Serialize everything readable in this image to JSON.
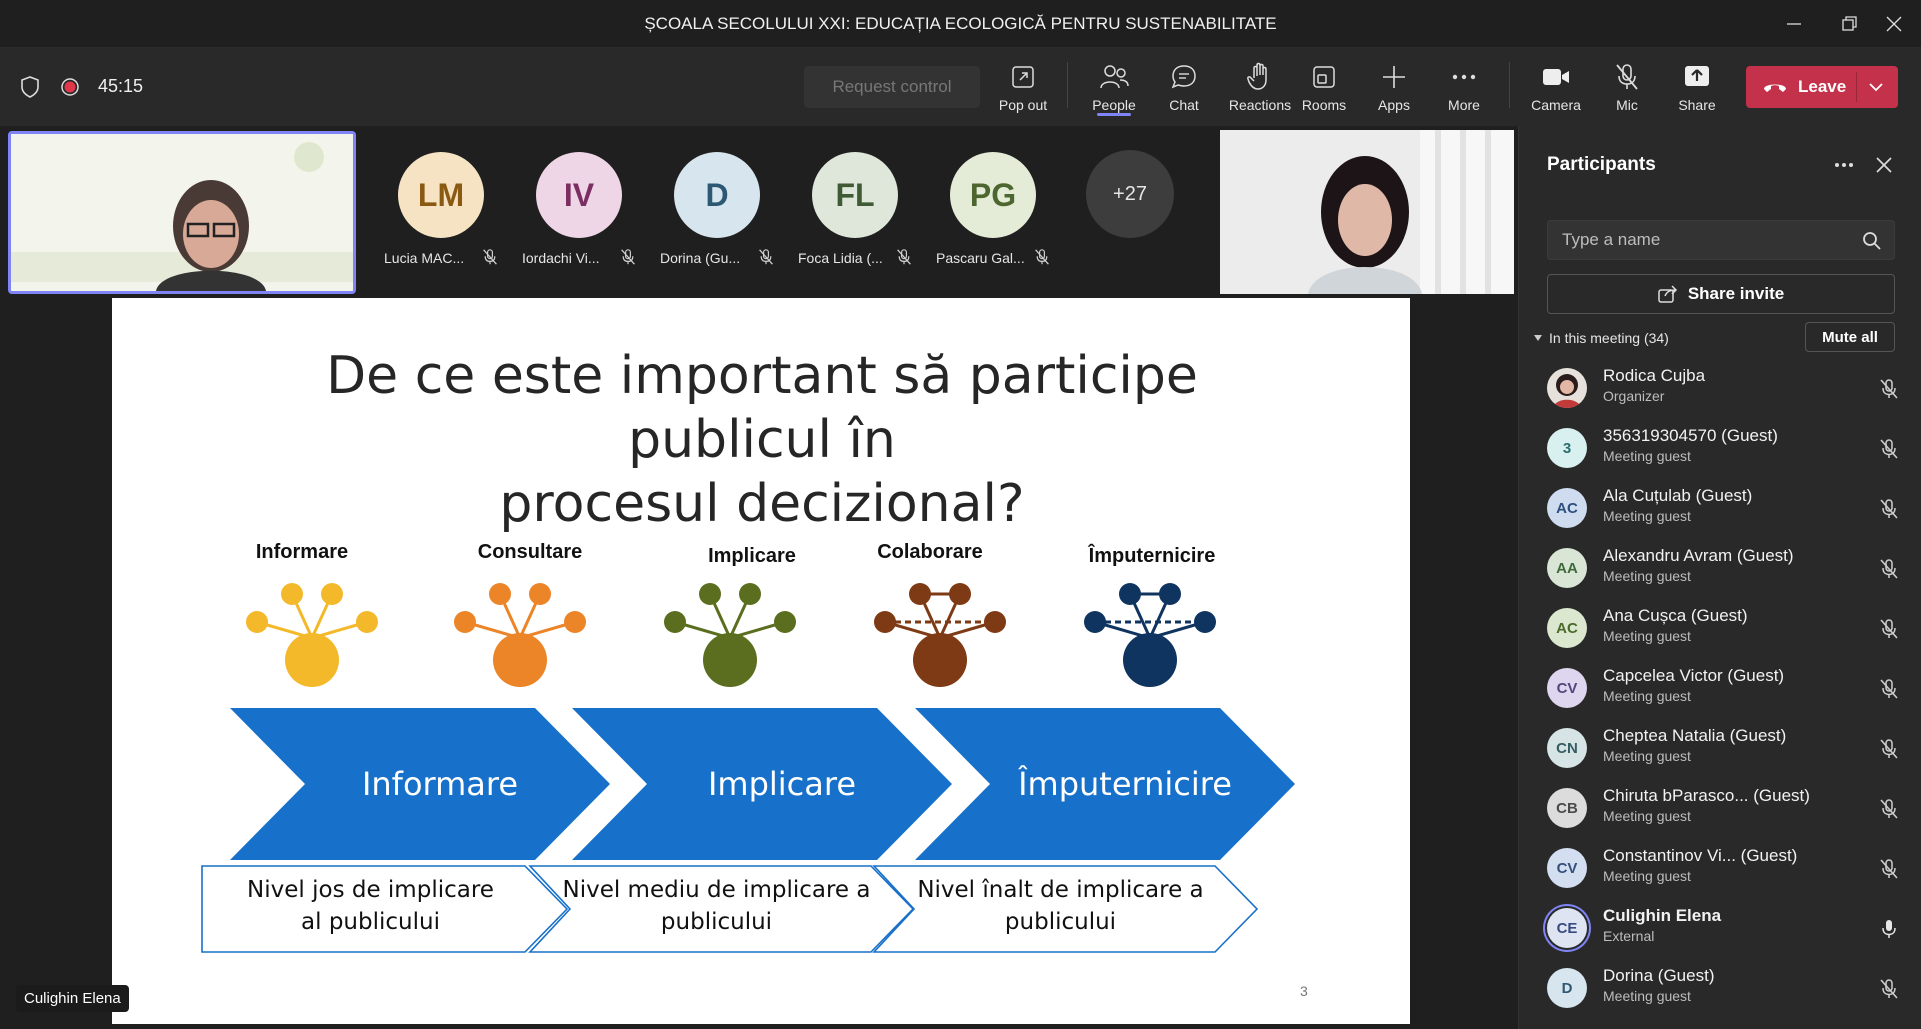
{
  "window": {
    "title": "ȘCOALA SECOLULUI XXI: EDUCAȚIA ECOLOGICĂ PENTRU SUSTENABILITATE"
  },
  "toolbar": {
    "timer": "45:15",
    "request_control": "Request control",
    "pop_out": "Pop out",
    "people": "People",
    "chat": "Chat",
    "reactions": "Reactions",
    "rooms": "Rooms",
    "apps": "Apps",
    "more": "More",
    "camera": "Camera",
    "mic": "Mic",
    "share": "Share",
    "leave": "Leave"
  },
  "gallery": {
    "tiles": [
      {
        "initials": "LM",
        "name": "Lucia MAC...",
        "bg": "#f6e3c3",
        "fg": "#8a5a12"
      },
      {
        "initials": "IV",
        "name": "Iordachi Vi...",
        "bg": "#efd6e6",
        "fg": "#7b2e62"
      },
      {
        "initials": "D",
        "name": "Dorina (Gu...",
        "bg": "#d7e5ee",
        "fg": "#2d5874"
      },
      {
        "initials": "FL",
        "name": "Foca Lidia (...",
        "bg": "#dfe6da",
        "fg": "#3f5a34"
      },
      {
        "initials": "PG",
        "name": "Pascaru Gal...",
        "bg": "#e4ecd7",
        "fg": "#4d6630"
      }
    ],
    "overflow": "+27"
  },
  "slide": {
    "title_line1": "De ce este important să participe publicul în",
    "title_line2": "procesul decizional?",
    "stages": [
      "Informare",
      "Consultare",
      "Implicare",
      "Colaborare",
      "Împuternicire"
    ],
    "stage_colors": [
      "#f4b92a",
      "#ec8428",
      "#5b6e1f",
      "#7e3a14",
      "#0f3460"
    ],
    "chevrons": [
      "Informare",
      "Implicare",
      "Împuternicire"
    ],
    "levels": [
      {
        "line1": "Nivel jos de implicare",
        "line2": "al publicului"
      },
      {
        "line1": "Nivel mediu de implicare a",
        "line2": "publicului"
      },
      {
        "line1": "Nivel înalt de implicare a",
        "line2": "publicului"
      }
    ],
    "page_number": "3",
    "chevron_color": "#1770c9"
  },
  "presenter_label": "Culighin Elena",
  "panel": {
    "title": "Participants",
    "search_placeholder": "Type a name",
    "share_invite": "Share invite",
    "in_meeting": "In this meeting (34)",
    "mute_all": "Mute all",
    "participants": [
      {
        "initials": "",
        "name": "Rodica Cujba",
        "role": "Organizer",
        "bg": "#8a6a5a",
        "fg": "#fff",
        "mic": "off",
        "photo": true
      },
      {
        "initials": "3",
        "name": "356319304570 (Guest)",
        "role": "Meeting guest",
        "bg": "#d8f0f0",
        "fg": "#2a6f6f",
        "mic": "off"
      },
      {
        "initials": "AC",
        "name": "Ala Cuțulab (Guest)",
        "role": "Meeting guest",
        "bg": "#cfdcef",
        "fg": "#2d4f80",
        "mic": "off"
      },
      {
        "initials": "AA",
        "name": "Alexandru Avram (Guest)",
        "role": "Meeting guest",
        "bg": "#d9e6d6",
        "fg": "#3f6a3a",
        "mic": "off"
      },
      {
        "initials": "AC",
        "name": "Ana Cușca (Guest)",
        "role": "Meeting guest",
        "bg": "#dbe8cf",
        "fg": "#4a6b2a",
        "mic": "off"
      },
      {
        "initials": "CV",
        "name": "Capcelea Victor (Guest)",
        "role": "Meeting guest",
        "bg": "#ded6ee",
        "fg": "#55437c",
        "mic": "off"
      },
      {
        "initials": "CN",
        "name": "Cheptea Natalia (Guest)",
        "role": "Meeting guest",
        "bg": "#d6e4e6",
        "fg": "#355d63",
        "mic": "off"
      },
      {
        "initials": "CB",
        "name": "Chiruta bParasco... (Guest)",
        "role": "Meeting guest",
        "bg": "#dcdcdc",
        "fg": "#4b4b4b",
        "mic": "off"
      },
      {
        "initials": "CV",
        "name": "Constantinov Vi...   (Guest)",
        "role": "Meeting guest",
        "bg": "#d3dff0",
        "fg": "#35507e",
        "mic": "off"
      },
      {
        "initials": "CE",
        "name": "Culighin Elena",
        "role": "External",
        "bg": "#dfe4f3",
        "fg": "#3a4a80",
        "mic": "on",
        "bold": true
      },
      {
        "initials": "D",
        "name": "Dorina (Guest)",
        "role": "Meeting guest",
        "bg": "#d7e5ee",
        "fg": "#2d5874",
        "mic": "off"
      }
    ]
  }
}
